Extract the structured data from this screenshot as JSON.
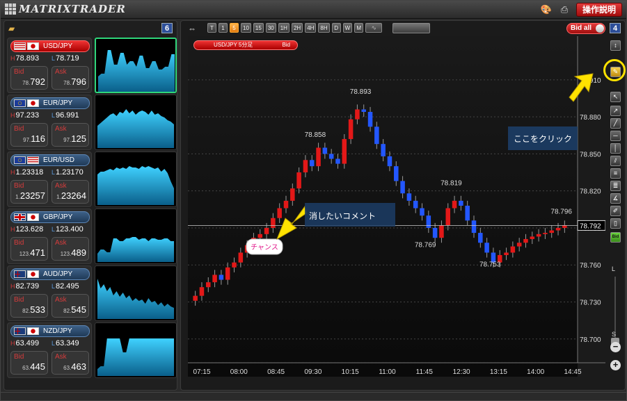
{
  "app": {
    "title": "MATRIXTRADER",
    "help_label": "操作説明"
  },
  "left_panel": {
    "count": "6",
    "pairs": [
      {
        "name": "USD/JPY",
        "flags": [
          "us",
          "jp"
        ],
        "high": "78.893",
        "low": "78.719",
        "bid_pre": "78.",
        "bid_main": "792",
        "ask_pre": "78.",
        "ask_main": "796",
        "active": true,
        "spark": [
          52,
          48,
          48,
          14,
          14,
          35,
          35,
          18,
          18,
          35,
          30,
          30,
          38,
          22,
          22,
          40,
          40,
          30,
          30,
          42,
          42,
          38,
          38,
          20,
          20
        ]
      },
      {
        "name": "EUR/JPY",
        "flags": [
          "eu",
          "jp"
        ],
        "high": "97.233",
        "low": "96.991",
        "bid_pre": "97.",
        "bid_main": "116",
        "ask_pre": "97.",
        "ask_main": "125",
        "active": false,
        "spark": [
          42,
          38,
          34,
          30,
          26,
          24,
          28,
          22,
          24,
          18,
          24,
          20,
          26,
          22,
          20,
          22,
          26,
          20,
          26,
          24,
          28,
          30,
          34,
          36,
          40
        ]
      },
      {
        "name": "EUR/USD",
        "flags": [
          "eu",
          "us"
        ],
        "high": "1.23318",
        "low": "1.23170",
        "bid_pre": "1.",
        "bid_main": "23257",
        "ask_pre": "1.",
        "ask_main": "23264",
        "active": false,
        "spark": [
          30,
          26,
          26,
          24,
          22,
          24,
          20,
          22,
          20,
          22,
          18,
          20,
          20,
          22,
          18,
          20,
          18,
          20,
          22,
          20,
          26,
          22,
          28,
          40,
          50
        ]
      },
      {
        "name": "GBP/JPY",
        "flags": [
          "gb",
          "jp"
        ],
        "high": "123.628",
        "low": "123.400",
        "bid_pre": "123.",
        "bid_main": "471",
        "ask_pre": "123.",
        "ask_main": "489",
        "active": false,
        "spark": [
          62,
          56,
          56,
          60,
          60,
          40,
          40,
          44,
          44,
          40,
          40,
          38,
          38,
          42,
          40,
          40,
          44,
          40,
          40,
          42,
          42,
          40,
          40,
          44,
          44
        ]
      },
      {
        "name": "AUD/JPY",
        "flags": [
          "au",
          "jp"
        ],
        "high": "82.739",
        "low": "82.495",
        "bid_pre": "82.",
        "bid_main": "533",
        "ask_pre": "82.",
        "ask_main": "545",
        "active": false,
        "spark": [
          16,
          30,
          24,
          34,
          28,
          40,
          34,
          42,
          36,
          44,
          40,
          48,
          44,
          48,
          46,
          52,
          44,
          50,
          48,
          54,
          50,
          56,
          52,
          56,
          58
        ]
      },
      {
        "name": "NZD/JPY",
        "flags": [
          "nz",
          "jp"
        ],
        "high": "63.499",
        "low": "63.349",
        "bid_pre": "63.",
        "bid_main": "445",
        "ask_pre": "63.",
        "ask_main": "463",
        "active": false,
        "spark": [
          64,
          60,
          60,
          20,
          20,
          20,
          20,
          20,
          40,
          40,
          20,
          20,
          20,
          20,
          20,
          20,
          20,
          20,
          20,
          20,
          20,
          20,
          20,
          20,
          20
        ]
      }
    ]
  },
  "toolbar": {
    "timeframes": [
      "T",
      "1",
      "5",
      "10",
      "15",
      "30",
      "1H",
      "2H",
      "4H",
      "8H",
      "D",
      "W",
      "M"
    ],
    "active_timeframe": "5",
    "bid_toggle": "Bid all",
    "count": "4"
  },
  "chart_tag": {
    "pair": "USD/JPY 5分足",
    "side": "Bid"
  },
  "chart_data": {
    "type": "candlestick",
    "x_ticks": [
      "07:15",
      "08:00",
      "08:45",
      "09:30",
      "10:15",
      "11:00",
      "11:45",
      "12:30",
      "13:15",
      "14:00",
      "14:45"
    ],
    "y_ticks": [
      "78.910",
      "78.880",
      "78.850",
      "78.820",
      "78.790",
      "78.760",
      "78.730",
      "78.700"
    ],
    "ylim": [
      78.683,
      78.942
    ],
    "current_price": "78.792",
    "peak_labels": [
      {
        "text": "78.893",
        "x": 26,
        "y": 78.893
      },
      {
        "text": "78.858",
        "x": 19,
        "y": 78.858
      },
      {
        "text": "78.819",
        "x": 40,
        "y": 78.819
      },
      {
        "text": "78.796",
        "x": 57,
        "y": 78.796
      },
      {
        "text": "78.769",
        "x": 36,
        "y": 78.769
      },
      {
        "text": "78.753",
        "x": 46,
        "y": 78.753
      }
    ]
  },
  "annotations": {
    "chance": "チャンス",
    "delete_comment": "消したいコメント",
    "click_here": "ここをクリック"
  }
}
